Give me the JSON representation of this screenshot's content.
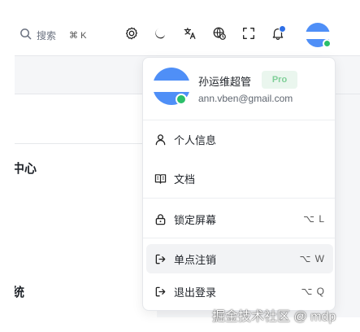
{
  "header": {
    "search_placeholder": "搜索",
    "search_shortcut": "⌘ K"
  },
  "icons": {
    "search": "search-icon",
    "settings": "gear-icon",
    "theme": "moon-icon",
    "language": "translate-icon",
    "timezone": "globe-clock-icon",
    "fullscreen": "fullscreen-icon",
    "notifications": "bell-icon"
  },
  "page": {
    "fragment_1": "中心",
    "fragment_2": "统"
  },
  "user_menu": {
    "name": "孙运维超管",
    "badge": "Pro",
    "email": "ann.vben@gmail.com",
    "items": [
      {
        "label": "个人信息",
        "shortcut": "",
        "icon": "user-icon"
      },
      {
        "label": "文档",
        "shortcut": "",
        "icon": "book-icon"
      },
      {
        "label": "锁定屏幕",
        "shortcut": "⌥ L",
        "icon": "lock-icon"
      },
      {
        "label": "单点注销",
        "shortcut": "⌥ W",
        "icon": "logout-icon"
      },
      {
        "label": "退出登录",
        "shortcut": "⌥ Q",
        "icon": "logout-icon"
      }
    ]
  },
  "watermark": "掘金技术社区 @ mdp",
  "colors": {
    "accent": "#4f8ff7",
    "online": "#2bbf6a",
    "notification_dot": "#2f6fe6",
    "pro_badge_bg": "#eaf6ee",
    "pro_badge_text": "#7fcf98"
  }
}
